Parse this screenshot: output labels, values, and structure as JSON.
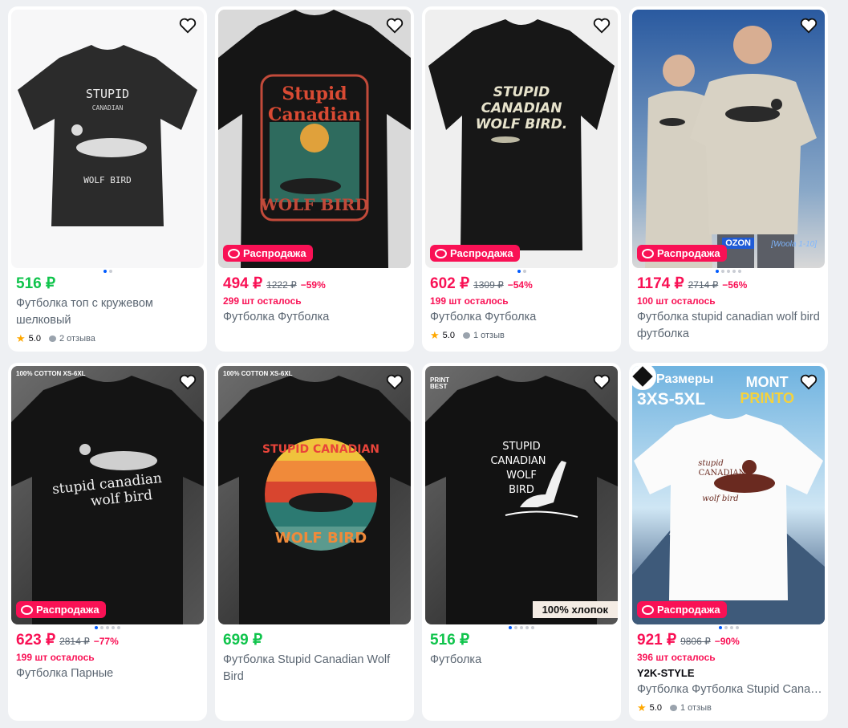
{
  "colors": {
    "accent": "#005bff",
    "sale": "#f91155",
    "price_green": "#10c44c",
    "star": "#ffa800"
  },
  "products": [
    {
      "price": "516 ₽",
      "title": "Футболка топ с кружевом шелковый",
      "rating": "5.0",
      "reviews": "2 отзыва",
      "dots": 2,
      "active_dot": 0
    },
    {
      "price": "494 ₽",
      "old_price": "1222 ₽",
      "discount": "−59%",
      "stock": "299 шт осталось",
      "sale_label": "Распродажа",
      "title": "Футболка Футболка",
      "print_line1": "Stupid",
      "print_line2": "Canadian",
      "print_line3": "WOLF BIRD"
    },
    {
      "price": "602 ₽",
      "old_price": "1309 ₽",
      "discount": "−54%",
      "stock": "199 шт осталось",
      "sale_label": "Распродажа",
      "title": "Футболка Футболка",
      "rating": "5.0",
      "reviews": "1 отзыв",
      "print_line1": "STUPID",
      "print_line2": "CANADIAN",
      "print_line3": "WOLF BIRD."
    },
    {
      "price": "1174 ₽",
      "old_price": "2714 ₽",
      "discount": "−56%",
      "stock": "100 шт осталось",
      "sale_label": "Распродажа",
      "title": "Футболка stupid canadian wolf bird футболка",
      "ozon": "OZON",
      "ozon_sub": "[Woola 1-10]"
    },
    {
      "price": "623 ₽",
      "old_price": "2814 ₽",
      "discount": "−77%",
      "stock": "199 шт осталось",
      "sale_label": "Распродажа",
      "title": "Футболка Парные",
      "tag": "100% COTTON XS-6XL",
      "print_line1": "stupid canadian",
      "print_line2": "wolf bird"
    },
    {
      "price": "699 ₽",
      "title": "Футболка Stupid Canadian Wolf Bird",
      "tag": "100% COTTON XS-6XL",
      "print_line1": "STUPID CANADIAN",
      "print_line2": "WOLF BIRD"
    },
    {
      "price": "516 ₽",
      "title": "Футболка",
      "badge": "100% хлопок",
      "logo": "PRINT BEST",
      "print_line1": "STUPID",
      "print_line2": "CANADIAN",
      "print_line3": "WOLF",
      "print_line4": "BIRD"
    },
    {
      "price": "921 ₽",
      "old_price": "9806 ₽",
      "discount": "−90%",
      "stock": "396 шт осталось",
      "sale_label": "Распродажа",
      "brand": "Y2K-STYLE",
      "title": "Футболка Футболка Stupid Canadian",
      "rating": "5.0",
      "reviews": "1 отзыв",
      "promo_sizes": "Размеры",
      "promo_range": "3XS-5XL",
      "promo_brand1": "MONT",
      "promo_brand2": "PRINTO",
      "print_line1": "stupid",
      "print_line2": "CANADIAN",
      "print_line3": "wolf bird"
    }
  ]
}
